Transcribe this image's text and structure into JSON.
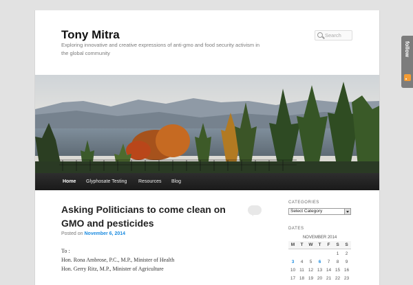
{
  "site": {
    "title": "Tony Mitra",
    "description": "Exploring innovative and creative expressions of anti-gmo and food security activism in the global community"
  },
  "search": {
    "placeholder": "Search"
  },
  "nav": {
    "items": [
      "Home",
      "Glyphosate Testing",
      "Resources",
      "Blog"
    ]
  },
  "post": {
    "title": "Asking Politicians to come clean on GMO and pesticides",
    "posted_on_label": "Posted on",
    "date": "November 6, 2014",
    "body_lines": [
      "To :",
      "Hon. Rona Ambrose, P.C., M.P., Minister of Health",
      "Hon. Gerry Ritz, M.P., Minister of Agriculture"
    ]
  },
  "sidebar": {
    "categories_title": "CATEGORIES",
    "categories_select": "Select Category",
    "dates_title": "DATES",
    "calendar": {
      "caption": "NOVEMBER 2014",
      "headers": [
        "M",
        "T",
        "W",
        "T",
        "F",
        "S",
        "S"
      ],
      "rows": [
        [
          "",
          "",
          "",
          "",
          "",
          "1",
          "2"
        ],
        [
          "3",
          "4",
          "5",
          "6",
          "7",
          "8",
          "9"
        ],
        [
          "10",
          "11",
          "12",
          "13",
          "14",
          "15",
          "16"
        ],
        [
          "17",
          "18",
          "19",
          "20",
          "21",
          "22",
          "23"
        ]
      ],
      "linked_days": [
        "3",
        "6"
      ]
    }
  },
  "follow": {
    "label": "follow"
  },
  "colors": {
    "accent": "#1b8be0",
    "nav_bg": "#222222",
    "follow_bg": "#7c7c7c"
  }
}
